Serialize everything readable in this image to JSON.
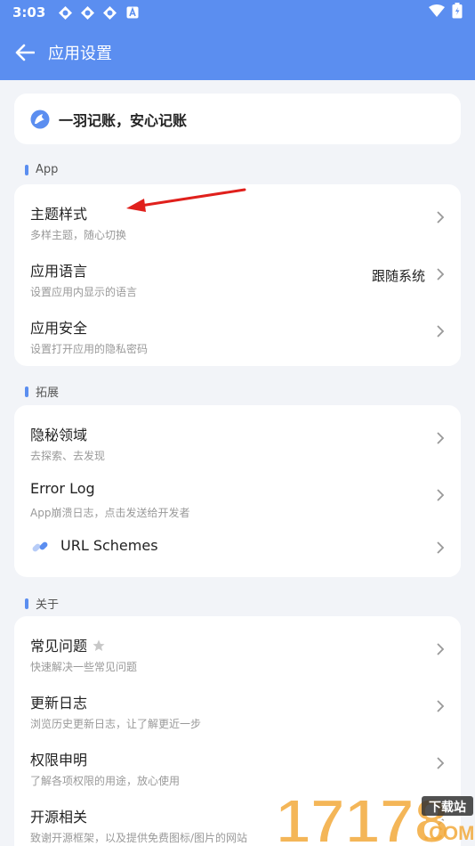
{
  "status": {
    "time": "3:03"
  },
  "appbar": {
    "title": "应用设置"
  },
  "banner": {
    "text": "一羽记账，安心记账"
  },
  "sections": {
    "app": {
      "label": "App",
      "items": [
        {
          "title": "主题样式",
          "subtitle": "多样主题，随心切换"
        },
        {
          "title": "应用语言",
          "subtitle": "设置应用内显示的语言",
          "value": "跟随系统"
        },
        {
          "title": "应用安全",
          "subtitle": "设置打开应用的隐私密码"
        }
      ]
    },
    "ext": {
      "label": "拓展",
      "items": [
        {
          "title": "隐秘领域",
          "subtitle": "去探索、去发现"
        },
        {
          "title": "Error Log",
          "subtitle": "App崩溃日志，点击发送给开发者"
        },
        {
          "title": "URL Schemes"
        }
      ]
    },
    "about": {
      "label": "关于",
      "items": [
        {
          "title": "常见问题",
          "subtitle": "快速解决一些常见问题"
        },
        {
          "title": "更新日志",
          "subtitle": "浏览历史更新日志，让了解更近一步"
        },
        {
          "title": "权限申明",
          "subtitle": "了解各项权限的用途，放心使用"
        },
        {
          "title": "开源相关",
          "subtitle": "致谢开源框架，以及提供免费图标/图片的网站"
        }
      ]
    }
  },
  "watermark": {
    "text": "17178",
    "tag": "下载站",
    "domain": ".COM"
  },
  "colors": {
    "primary": "#5b8ef0",
    "background": "#f2f4f8",
    "arrow": "#e0201c"
  }
}
